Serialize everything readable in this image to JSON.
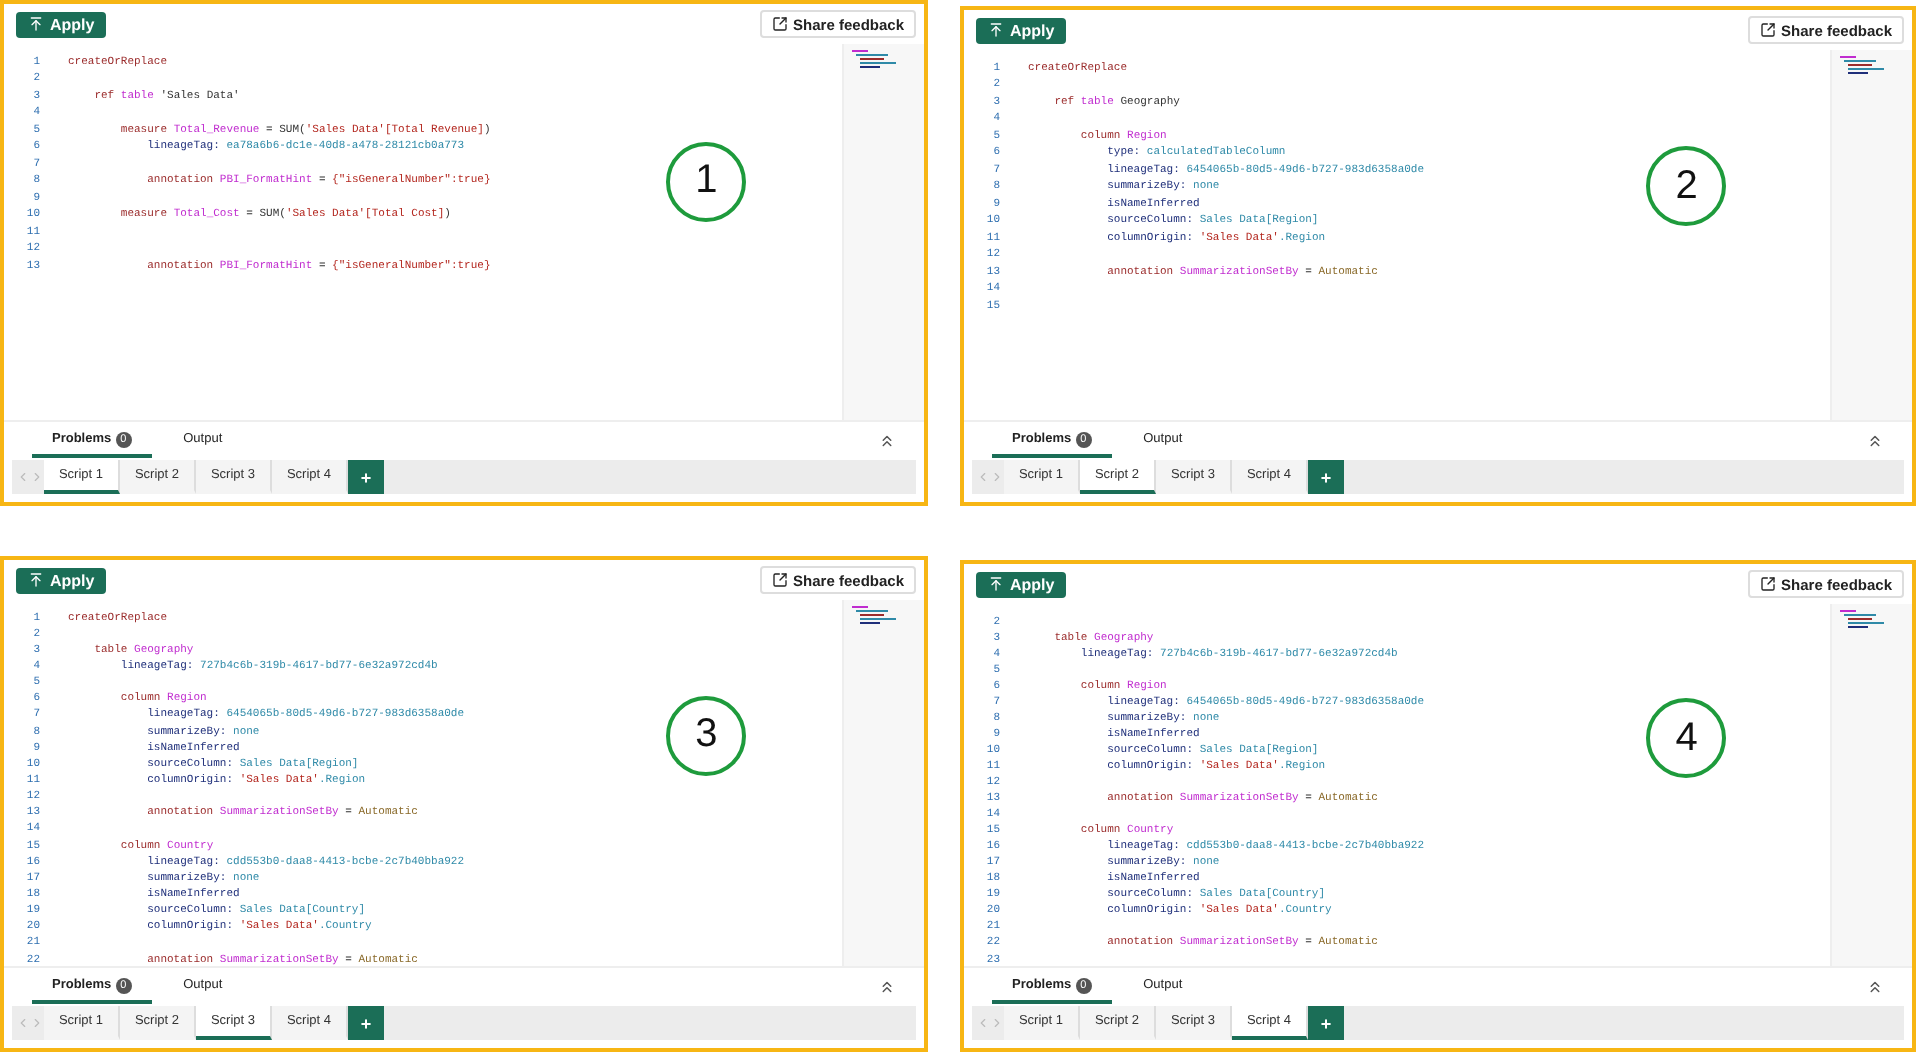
{
  "panels": [
    {
      "marker": "1",
      "apply_label": "Apply",
      "feedback_label": "Share feedback",
      "add_label": "+",
      "lines": [
        {
          "number": "1",
          "tokens": [
            {
              "text": "createOrReplace",
              "kind": "keyword"
            }
          ]
        },
        {
          "number": "2"
        },
        {
          "number": "3",
          "tokens": [
            {
              "text": "    ref ",
              "kind": "keyword"
            },
            {
              "text": "table ",
              "kind": "name"
            },
            {
              "text": "'Sales Data'",
              "kind": "plain"
            }
          ]
        },
        {
          "number": "4"
        },
        {
          "number": "5",
          "tokens": [
            {
              "text": "        measure ",
              "kind": "keyword"
            },
            {
              "text": "Total_Revenue",
              "kind": "name"
            },
            {
              "text": " = SUM(",
              "kind": "plain"
            },
            {
              "text": "'Sales Data'[Total Revenue]",
              "kind": "string"
            },
            {
              "text": ")",
              "kind": "plain"
            }
          ]
        },
        {
          "number": "6",
          "tokens": [
            {
              "text": "            lineageTag: ",
              "kind": "prop"
            },
            {
              "text": "ea78a6b6-dc1e-40d8-a478-28121cb0a773",
              "kind": "value"
            }
          ]
        },
        {
          "number": "7"
        },
        {
          "number": "8",
          "tokens": [
            {
              "text": "            annotation ",
              "kind": "keyword"
            },
            {
              "text": "PBI_FormatHint",
              "kind": "name"
            },
            {
              "text": " = ",
              "kind": "plain"
            },
            {
              "text": "{\"isGeneralNumber\":true}",
              "kind": "string"
            }
          ]
        },
        {
          "number": "9"
        },
        {
          "number": "10",
          "tokens": [
            {
              "text": "        measure ",
              "kind": "keyword"
            },
            {
              "text": "Total_Cost",
              "kind": "name"
            },
            {
              "text": " = SUM(",
              "kind": "plain"
            },
            {
              "text": "'Sales Data'[Total Cost]",
              "kind": "string"
            },
            {
              "text": ")",
              "kind": "plain"
            }
          ]
        },
        {
          "number": "11"
        },
        {
          "number": "12"
        },
        {
          "number": "13",
          "tokens": [
            {
              "text": "            annotation ",
              "kind": "keyword"
            },
            {
              "text": "PBI_FormatHint",
              "kind": "name"
            },
            {
              "text": " = ",
              "kind": "plain"
            },
            {
              "text": "{\"isGeneralNumber\":true}",
              "kind": "string"
            }
          ]
        }
      ],
      "bottom_tabs": [
        {
          "label": "Problems",
          "badge": "0",
          "selected": true
        },
        {
          "label": "Output",
          "selected": false
        }
      ],
      "script_tabs": [
        {
          "label": "Script 1",
          "selected": true
        },
        {
          "label": "Script 2",
          "selected": false
        },
        {
          "label": "Script 3",
          "selected": false
        },
        {
          "label": "Script 4",
          "selected": false
        }
      ]
    },
    {
      "marker": "2",
      "apply_label": "Apply",
      "feedback_label": "Share feedback",
      "add_label": "+",
      "lines": [
        {
          "number": "1",
          "tokens": [
            {
              "text": "createOrReplace",
              "kind": "keyword"
            }
          ]
        },
        {
          "number": "2"
        },
        {
          "number": "3",
          "tokens": [
            {
              "text": "    ref ",
              "kind": "keyword"
            },
            {
              "text": "table ",
              "kind": "name"
            },
            {
              "text": "Geography",
              "kind": "plain"
            }
          ]
        },
        {
          "number": "4"
        },
        {
          "number": "5",
          "tokens": [
            {
              "text": "        column ",
              "kind": "keyword"
            },
            {
              "text": "Region",
              "kind": "name"
            }
          ]
        },
        {
          "number": "6",
          "tokens": [
            {
              "text": "            type: ",
              "kind": "prop"
            },
            {
              "text": "calculatedTableColumn",
              "kind": "value"
            }
          ]
        },
        {
          "number": "7",
          "tokens": [
            {
              "text": "            lineageTag: ",
              "kind": "prop"
            },
            {
              "text": "6454065b-80d5-49d6-b727-983d6358a0de",
              "kind": "value"
            }
          ]
        },
        {
          "number": "8",
          "tokens": [
            {
              "text": "            summarizeBy: ",
              "kind": "prop"
            },
            {
              "text": "none",
              "kind": "value"
            }
          ]
        },
        {
          "number": "9",
          "tokens": [
            {
              "text": "            isNameInferred",
              "kind": "prop"
            }
          ]
        },
        {
          "number": "10",
          "tokens": [
            {
              "text": "            sourceColumn: ",
              "kind": "prop"
            },
            {
              "text": "Sales Data[Region]",
              "kind": "value"
            }
          ]
        },
        {
          "number": "11",
          "tokens": [
            {
              "text": "            columnOrigin: ",
              "kind": "prop"
            },
            {
              "text": "'Sales Data'",
              "kind": "string"
            },
            {
              "text": ".Region",
              "kind": "value"
            }
          ]
        },
        {
          "number": "12"
        },
        {
          "number": "13",
          "tokens": [
            {
              "text": "            annotation ",
              "kind": "keyword"
            },
            {
              "text": "SummarizationSetBy",
              "kind": "name"
            },
            {
              "text": " = ",
              "kind": "plain"
            },
            {
              "text": "Automatic",
              "kind": "auto"
            }
          ]
        },
        {
          "number": "14"
        },
        {
          "number": "15"
        }
      ],
      "bottom_tabs": [
        {
          "label": "Problems",
          "badge": "0",
          "selected": true
        },
        {
          "label": "Output",
          "selected": false
        }
      ],
      "script_tabs": [
        {
          "label": "Script 1",
          "selected": false
        },
        {
          "label": "Script 2",
          "selected": true
        },
        {
          "label": "Script 3",
          "selected": false
        },
        {
          "label": "Script 4",
          "selected": false
        }
      ]
    },
    {
      "marker": "3",
      "apply_label": "Apply",
      "feedback_label": "Share feedback",
      "add_label": "+",
      "lines": [
        {
          "number": "1",
          "tokens": [
            {
              "text": "createOrReplace",
              "kind": "keyword"
            }
          ]
        },
        {
          "number": "2"
        },
        {
          "number": "3",
          "tokens": [
            {
              "text": "    table ",
              "kind": "keyword"
            },
            {
              "text": "Geography",
              "kind": "name"
            }
          ]
        },
        {
          "number": "4",
          "tokens": [
            {
              "text": "        lineageTag: ",
              "kind": "prop"
            },
            {
              "text": "727b4c6b-319b-4617-bd77-6e32a972cd4b",
              "kind": "value"
            }
          ]
        },
        {
          "number": "5"
        },
        {
          "number": "6",
          "tokens": [
            {
              "text": "        column ",
              "kind": "keyword"
            },
            {
              "text": "Region",
              "kind": "name"
            }
          ]
        },
        {
          "number": "7",
          "tokens": [
            {
              "text": "            lineageTag: ",
              "kind": "prop"
            },
            {
              "text": "6454065b-80d5-49d6-b727-983d6358a0de",
              "kind": "value"
            }
          ]
        },
        {
          "number": "8",
          "tokens": [
            {
              "text": "            summarizeBy: ",
              "kind": "prop"
            },
            {
              "text": "none",
              "kind": "value"
            }
          ]
        },
        {
          "number": "9",
          "tokens": [
            {
              "text": "            isNameInferred",
              "kind": "prop"
            }
          ]
        },
        {
          "number": "10",
          "tokens": [
            {
              "text": "            sourceColumn: ",
              "kind": "prop"
            },
            {
              "text": "Sales Data[Region]",
              "kind": "value"
            }
          ]
        },
        {
          "number": "11",
          "tokens": [
            {
              "text": "            columnOrigin: ",
              "kind": "prop"
            },
            {
              "text": "'Sales Data'",
              "kind": "string"
            },
            {
              "text": ".Region",
              "kind": "value"
            }
          ]
        },
        {
          "number": "12"
        },
        {
          "number": "13",
          "tokens": [
            {
              "text": "            annotation ",
              "kind": "keyword"
            },
            {
              "text": "SummarizationSetBy",
              "kind": "name"
            },
            {
              "text": " = ",
              "kind": "plain"
            },
            {
              "text": "Automatic",
              "kind": "auto"
            }
          ]
        },
        {
          "number": "14"
        },
        {
          "number": "15",
          "tokens": [
            {
              "text": "        column ",
              "kind": "keyword"
            },
            {
              "text": "Country",
              "kind": "name"
            }
          ]
        },
        {
          "number": "16",
          "tokens": [
            {
              "text": "            lineageTag: ",
              "kind": "prop"
            },
            {
              "text": "cdd553b0-daa8-4413-bcbe-2c7b40bba922",
              "kind": "value"
            }
          ]
        },
        {
          "number": "17",
          "tokens": [
            {
              "text": "            summarizeBy: ",
              "kind": "prop"
            },
            {
              "text": "none",
              "kind": "value"
            }
          ]
        },
        {
          "number": "18",
          "tokens": [
            {
              "text": "            isNameInferred",
              "kind": "prop"
            }
          ]
        },
        {
          "number": "19",
          "tokens": [
            {
              "text": "            sourceColumn: ",
              "kind": "prop"
            },
            {
              "text": "Sales Data[Country]",
              "kind": "value"
            }
          ]
        },
        {
          "number": "20",
          "tokens": [
            {
              "text": "            columnOrigin: ",
              "kind": "prop"
            },
            {
              "text": "'Sales Data'",
              "kind": "string"
            },
            {
              "text": ".Country",
              "kind": "value"
            }
          ]
        },
        {
          "number": "21"
        },
        {
          "number": "22",
          "tokens": [
            {
              "text": "            annotation ",
              "kind": "keyword"
            },
            {
              "text": "SummarizationSetBy",
              "kind": "name"
            },
            {
              "text": " = ",
              "kind": "plain"
            },
            {
              "text": "Automatic",
              "kind": "auto"
            }
          ]
        }
      ],
      "bottom_tabs": [
        {
          "label": "Problems",
          "badge": "0",
          "selected": true
        },
        {
          "label": "Output",
          "selected": false
        }
      ],
      "script_tabs": [
        {
          "label": "Script 1",
          "selected": false
        },
        {
          "label": "Script 2",
          "selected": false
        },
        {
          "label": "Script 3",
          "selected": true
        },
        {
          "label": "Script 4",
          "selected": false
        }
      ]
    },
    {
      "marker": "4",
      "apply_label": "Apply",
      "feedback_label": "Share feedback",
      "add_label": "+",
      "lines": [
        {
          "number": "2"
        },
        {
          "number": "3",
          "tokens": [
            {
              "text": "    table ",
              "kind": "keyword"
            },
            {
              "text": "Geography",
              "kind": "name"
            }
          ]
        },
        {
          "number": "4",
          "tokens": [
            {
              "text": "        lineageTag: ",
              "kind": "prop"
            },
            {
              "text": "727b4c6b-319b-4617-bd77-6e32a972cd4b",
              "kind": "value"
            }
          ]
        },
        {
          "number": "5"
        },
        {
          "number": "6",
          "tokens": [
            {
              "text": "        column ",
              "kind": "keyword"
            },
            {
              "text": "Region",
              "kind": "name"
            }
          ]
        },
        {
          "number": "7",
          "tokens": [
            {
              "text": "            lineageTag: ",
              "kind": "prop"
            },
            {
              "text": "6454065b-80d5-49d6-b727-983d6358a0de",
              "kind": "value"
            }
          ]
        },
        {
          "number": "8",
          "tokens": [
            {
              "text": "            summarizeBy: ",
              "kind": "prop"
            },
            {
              "text": "none",
              "kind": "value"
            }
          ]
        },
        {
          "number": "9",
          "tokens": [
            {
              "text": "            isNameInferred",
              "kind": "prop"
            }
          ]
        },
        {
          "number": "10",
          "tokens": [
            {
              "text": "            sourceColumn: ",
              "kind": "prop"
            },
            {
              "text": "Sales Data[Region]",
              "kind": "value"
            }
          ]
        },
        {
          "number": "11",
          "tokens": [
            {
              "text": "            columnOrigin: ",
              "kind": "prop"
            },
            {
              "text": "'Sales Data'",
              "kind": "string"
            },
            {
              "text": ".Region",
              "kind": "value"
            }
          ]
        },
        {
          "number": "12"
        },
        {
          "number": "13",
          "tokens": [
            {
              "text": "            annotation ",
              "kind": "keyword"
            },
            {
              "text": "SummarizationSetBy",
              "kind": "name"
            },
            {
              "text": " = ",
              "kind": "plain"
            },
            {
              "text": "Automatic",
              "kind": "auto"
            }
          ]
        },
        {
          "number": "14"
        },
        {
          "number": "15",
          "tokens": [
            {
              "text": "        column ",
              "kind": "keyword"
            },
            {
              "text": "Country",
              "kind": "name"
            }
          ]
        },
        {
          "number": "16",
          "tokens": [
            {
              "text": "            lineageTag: ",
              "kind": "prop"
            },
            {
              "text": "cdd553b0-daa8-4413-bcbe-2c7b40bba922",
              "kind": "value"
            }
          ]
        },
        {
          "number": "17",
          "tokens": [
            {
              "text": "            summarizeBy: ",
              "kind": "prop"
            },
            {
              "text": "none",
              "kind": "value"
            }
          ]
        },
        {
          "number": "18",
          "tokens": [
            {
              "text": "            isNameInferred",
              "kind": "prop"
            }
          ]
        },
        {
          "number": "19",
          "tokens": [
            {
              "text": "            sourceColumn: ",
              "kind": "prop"
            },
            {
              "text": "Sales Data[Country]",
              "kind": "value"
            }
          ]
        },
        {
          "number": "20",
          "tokens": [
            {
              "text": "            columnOrigin: ",
              "kind": "prop"
            },
            {
              "text": "'Sales Data'",
              "kind": "string"
            },
            {
              "text": ".Country",
              "kind": "value"
            }
          ]
        },
        {
          "number": "21"
        },
        {
          "number": "22",
          "tokens": [
            {
              "text": "            annotation ",
              "kind": "keyword"
            },
            {
              "text": "SummarizationSetBy",
              "kind": "name"
            },
            {
              "text": " = ",
              "kind": "plain"
            },
            {
              "text": "Automatic",
              "kind": "auto"
            }
          ]
        },
        {
          "number": "23"
        }
      ],
      "bottom_tabs": [
        {
          "label": "Problems",
          "badge": "0",
          "selected": true
        },
        {
          "label": "Output",
          "selected": false
        }
      ],
      "script_tabs": [
        {
          "label": "Script 1",
          "selected": false
        },
        {
          "label": "Script 2",
          "selected": false
        },
        {
          "label": "Script 3",
          "selected": false
        },
        {
          "label": "Script 4",
          "selected": true
        }
      ]
    }
  ]
}
